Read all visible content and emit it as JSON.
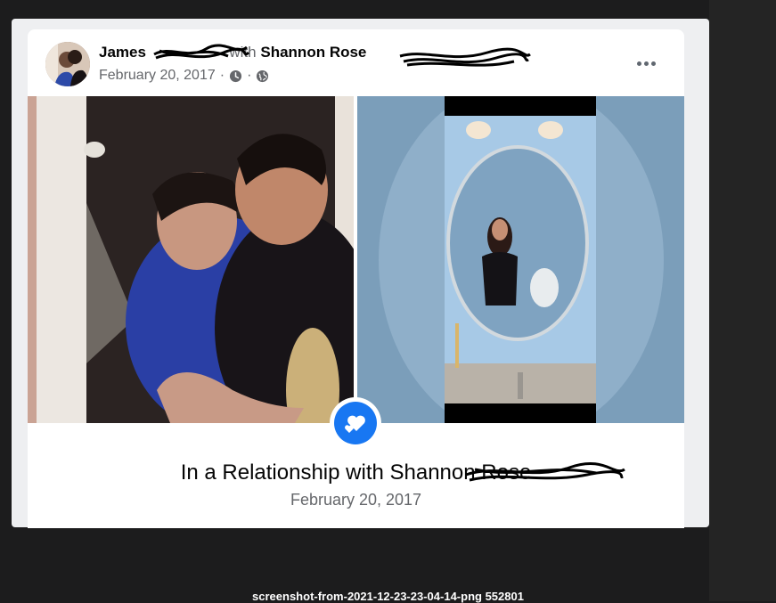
{
  "post": {
    "author_first": "James",
    "with_word": "with",
    "tagged_name": "Shannon Rose",
    "date": "February 20, 2017",
    "separator": "·",
    "menu_icon": "more-horizontal-icon",
    "privacy_icons": [
      "clock-icon",
      "globe-icon"
    ]
  },
  "life_event": {
    "icon": "hearts-icon",
    "title": "In a Relationship with Shannon Rose",
    "date": "February 20, 2017"
  },
  "footer": {
    "caption": "screenshot-from-2021-12-23-23-04-14-png 552801"
  },
  "colors": {
    "accent": "#1877f2",
    "card_bg": "#ffffff",
    "page_bg": "#1c1c1d",
    "secondary_text": "#65676b"
  }
}
